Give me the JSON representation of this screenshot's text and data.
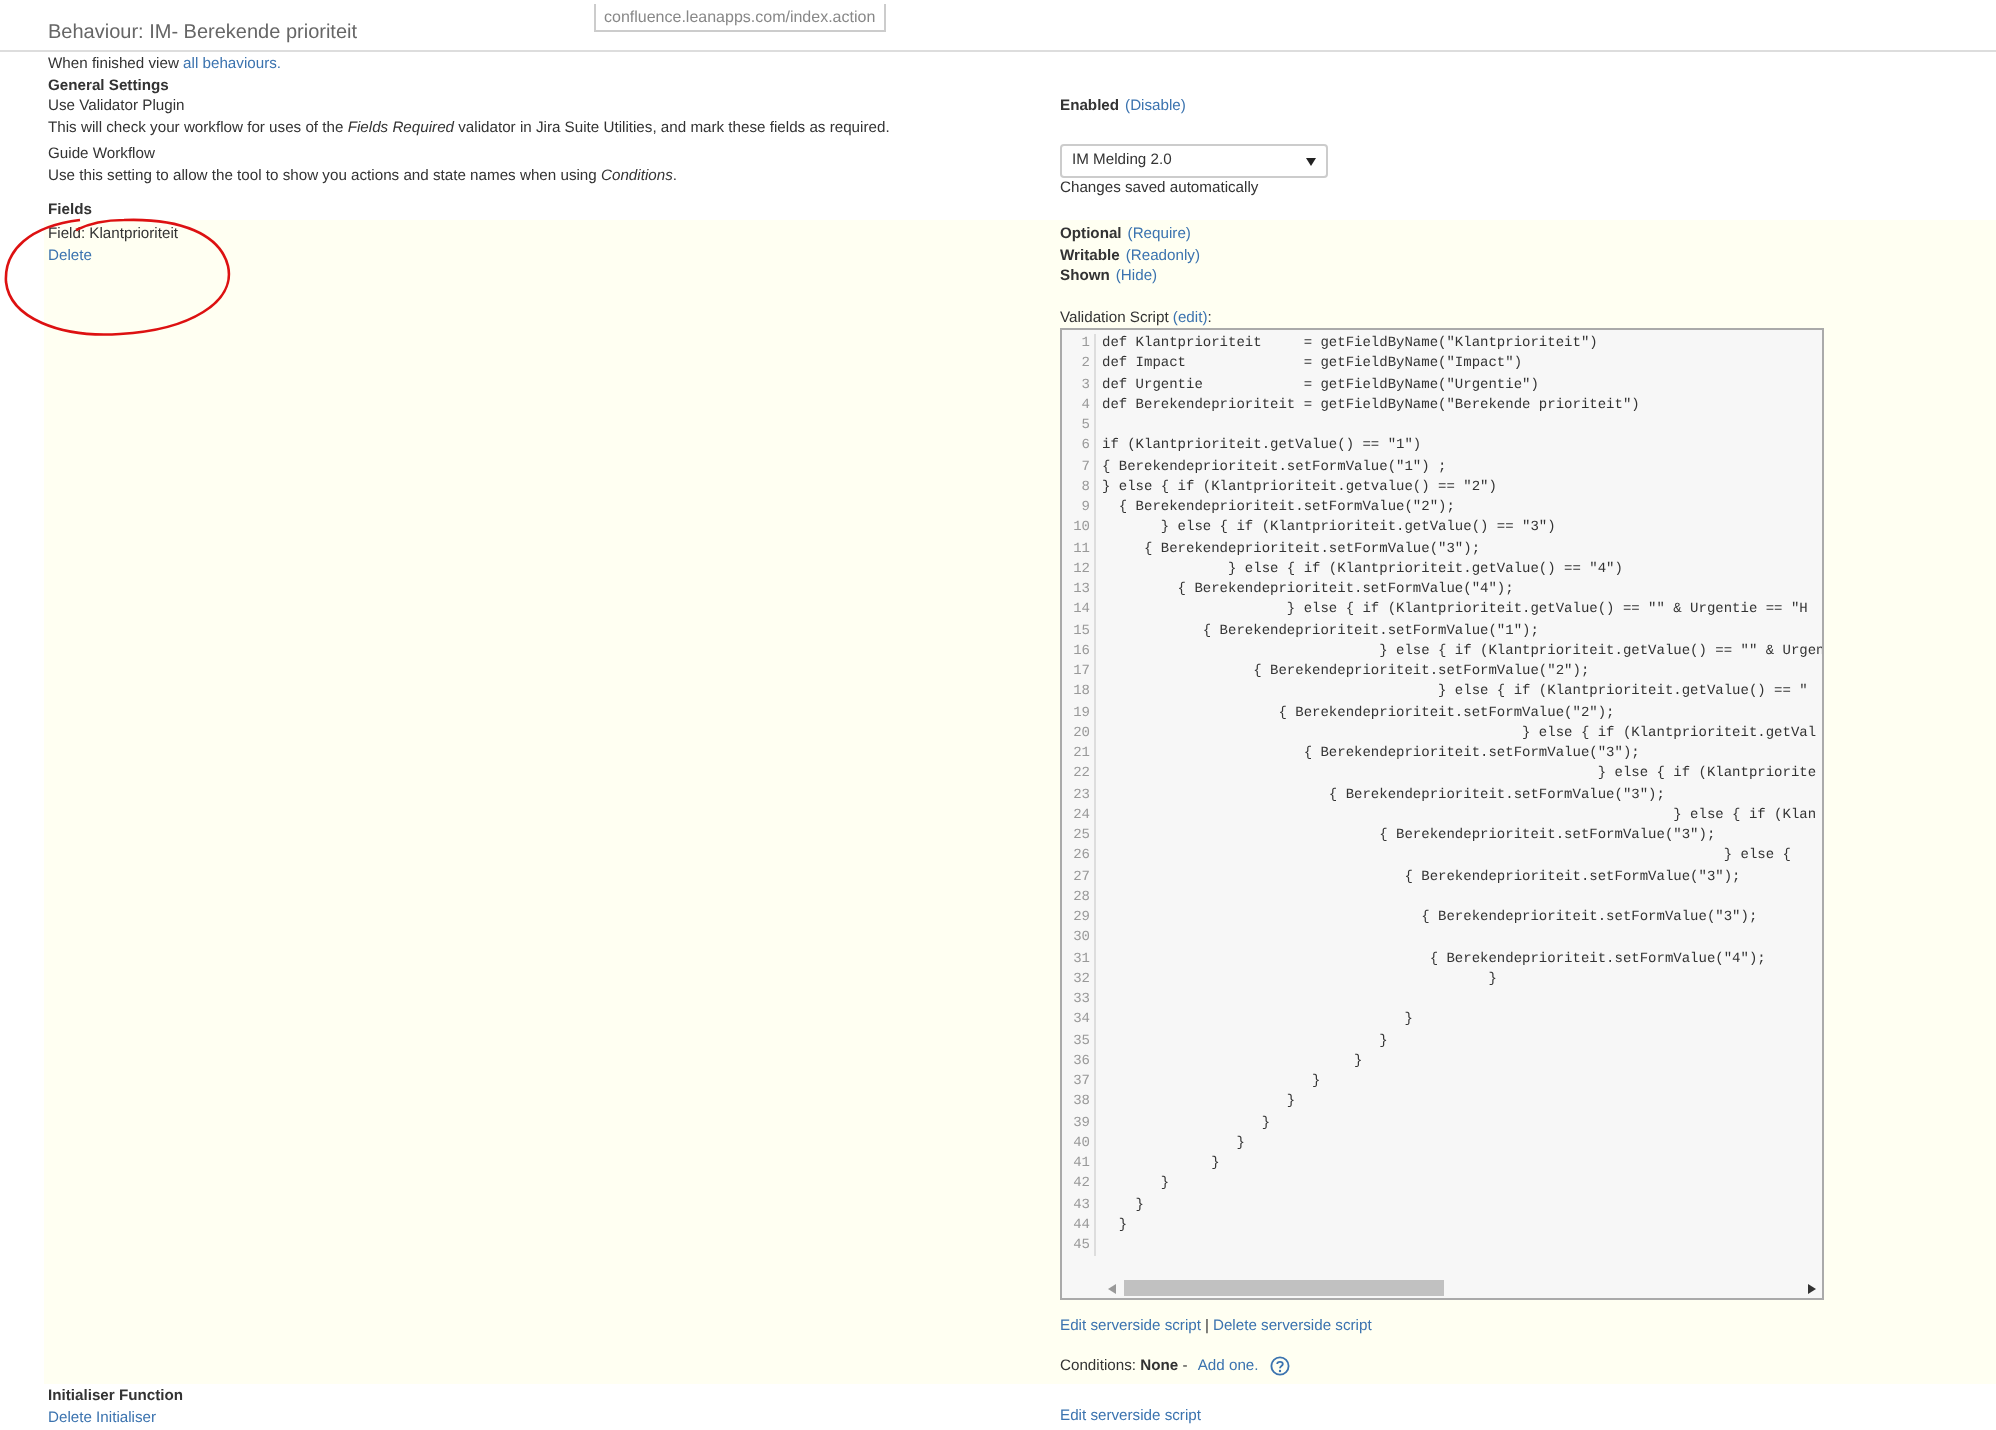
{
  "tooltip": {
    "url": "confluence.leanapps.com/index.action"
  },
  "title": "Behaviour: IM- Berekende prioriteit",
  "finished_note": {
    "text": "When finished view ",
    "link": "all behaviours."
  },
  "general_settings": {
    "heading": "General Settings",
    "validator_plugin": {
      "label": "Use Validator Plugin",
      "description": "This will check your workflow for uses of the *Fields Required* validator in Jira Suite Utilities, and mark these fields as required.",
      "status": "Enabled",
      "action": "(Disable)"
    },
    "guide_workflow": {
      "label": "Guide Workflow",
      "description": "Use this setting to allow the tool to show you actions and state names when using *Conditions*.",
      "dropdown": "IM Melding 2.0",
      "note": "Changes saved automatically"
    }
  },
  "fields": {
    "heading": "Fields",
    "name": "Field: Klantprioriteit",
    "delete": "Delete",
    "flags": [
      {
        "state": "Optional",
        "action": "(Require)"
      },
      {
        "state": "Writable",
        "action": "(Readonly)"
      },
      {
        "state": "Shown",
        "action": "(Hide)"
      }
    ],
    "script_label": "Validation Script ",
    "script_edit": "(edit)",
    "script_suffix": ":",
    "lines": [
      {
        "n": "1",
        "code": "def Klantprioriteit     = getFieldByName(\"Klantprioriteit\")"
      },
      {
        "n": "2",
        "code": "def Impact              = getFieldByName(\"Impact\")"
      },
      {
        "n": "3",
        "code": "def Urgentie            = getFieldByName(\"Urgentie\")"
      },
      {
        "n": "4",
        "code": "def Berekendeprioriteit = getFieldByName(\"Berekende prioriteit\")"
      },
      {
        "n": "5"
      },
      {
        "n": "6",
        "code": "if (Klantprioriteit.getValue() == \"1\")"
      },
      {
        "n": "7",
        "code": "{ Berekendeprioriteit.setFormValue(\"1\") ;"
      },
      {
        "n": "8",
        "code": "} else { if (Klantprioriteit.getvalue() == \"2\")"
      },
      {
        "n": "9",
        "code": "  { Berekendeprioriteit.setFormValue(\"2\");"
      },
      {
        "n": "10",
        "code": "       } else { if (Klantprioriteit.getValue() == \"3\")"
      },
      {
        "n": "11",
        "code": "     { Berekendeprioriteit.setFormValue(\"3\");"
      },
      {
        "n": "12",
        "code": "               } else { if (Klantprioriteit.getValue() == \"4\")"
      },
      {
        "n": "13",
        "code": "         { Berekendeprioriteit.setFormValue(\"4\");"
      },
      {
        "n": "14",
        "code": "                      } else { if (Klantprioriteit.getValue() == \"\" & Urgentie == \"H"
      },
      {
        "n": "15",
        "code": "            { Berekendeprioriteit.setFormValue(\"1\");"
      },
      {
        "n": "16",
        "code": "                                 } else { if (Klantprioriteit.getValue() == \"\" & Urgen"
      },
      {
        "n": "17",
        "code": "                  { Berekendeprioriteit.setFormValue(\"2\");"
      },
      {
        "n": "18",
        "code": "                                        } else { if (Klantprioriteit.getValue() == \""
      },
      {
        "n": "19",
        "code": "                     { Berekendeprioriteit.setFormValue(\"2\");"
      },
      {
        "n": "20",
        "code": "                                                  } else { if (Klantprioriteit.getVal"
      },
      {
        "n": "21",
        "code": "                        { Berekendeprioriteit.setFormValue(\"3\");"
      },
      {
        "n": "22",
        "code": "                                                           } else { if (Klantpriorite"
      },
      {
        "n": "23",
        "code": "                           { Berekendeprioriteit.setFormValue(\"3\");"
      },
      {
        "n": "24",
        "code": "                                                                    } else { if (Klan"
      },
      {
        "n": "25",
        "code": "                                 { Berekendeprioriteit.setFormValue(\"3\");"
      },
      {
        "n": "26",
        "code": "                                                                          } else {"
      },
      {
        "n": "27",
        "code": "                                    { Berekendeprioriteit.setFormValue(\"3\");"
      },
      {
        "n": "28"
      },
      {
        "n": "29",
        "code": "                                      { Berekendeprioriteit.setFormValue(\"3\");"
      },
      {
        "n": "30"
      },
      {
        "n": "31",
        "code": "                                       { Berekendeprioriteit.setFormValue(\"4\");"
      },
      {
        "n": "32",
        "code": "                                              }"
      },
      {
        "n": "33"
      },
      {
        "n": "34",
        "code": "                                    }"
      },
      {
        "n": "35",
        "code": "                                 }"
      },
      {
        "n": "36",
        "code": "                              }"
      },
      {
        "n": "37",
        "code": "                         }"
      },
      {
        "n": "38",
        "code": "                      }"
      },
      {
        "n": "39",
        "code": "                   }"
      },
      {
        "n": "40",
        "code": "                }"
      },
      {
        "n": "41",
        "code": "             }"
      },
      {
        "n": "42",
        "code": "       }"
      },
      {
        "n": "43",
        "code": "    }"
      },
      {
        "n": "44",
        "code": "  }"
      },
      {
        "n": "45"
      }
    ],
    "script_links": [
      "Edit serverside script",
      "Delete serverside script"
    ],
    "separator": "|",
    "conditions": {
      "text": "Conditions: **None** - ",
      "link": "Add one."
    }
  },
  "initialiser": {
    "heading": "Initialiser Function",
    "delete": "Delete Initialiser",
    "script_link": "Edit serverside script"
  }
}
